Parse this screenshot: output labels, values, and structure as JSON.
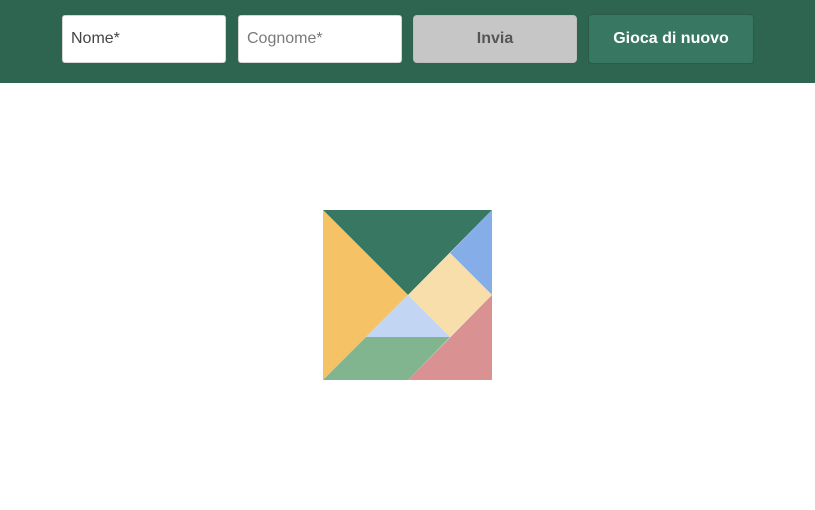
{
  "form": {
    "first_name_placeholder": "Nome*",
    "last_name_placeholder": "Cognome*",
    "submit_label": "Invia",
    "play_again_label": "Gioca di nuovo"
  },
  "colors": {
    "header_bg": "#2e6551",
    "large_triangle_top": "#387863",
    "large_triangle_left": "#f5c265",
    "small_triangle_top_right": "#85aee8",
    "square": "#f7deab",
    "small_triangle_center": "#c2d6f3",
    "parallelogram": "#80b590",
    "medium_triangle": "#d99191"
  }
}
